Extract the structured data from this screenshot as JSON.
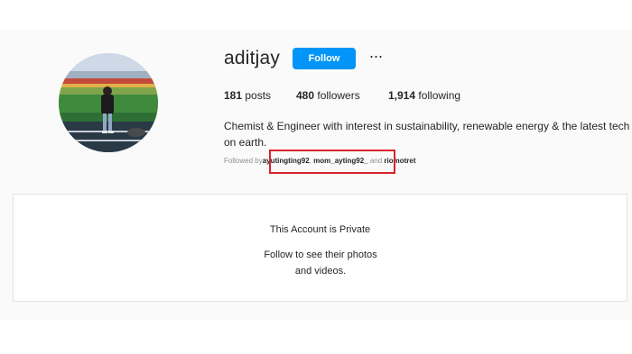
{
  "profile": {
    "username": "aditjay",
    "follow_label": "Follow",
    "more_label": "···",
    "stats": [
      {
        "count": "181",
        "label": "posts"
      },
      {
        "count": "480",
        "label": "followers"
      },
      {
        "count": "1,914",
        "label": "following"
      }
    ],
    "bio": "Chemist & Engineer with interest in sustainability, renewable energy & the latest tech on earth.",
    "followed_by": {
      "prefix": "Followed by",
      "accounts": [
        "ayutingting92",
        "mom_ayting92_",
        "riomotret"
      ],
      "separator": ", ",
      "conjunction": " and "
    }
  },
  "private_notice": {
    "title": "This Account is Private",
    "subtitle": "Follow to see their photos and videos."
  },
  "colors": {
    "follow_button": "#0095f6",
    "highlight_box": "#d9232d",
    "text": "#262626",
    "muted": "#8e8e8e"
  },
  "icons": {
    "more": "more-options-icon"
  }
}
